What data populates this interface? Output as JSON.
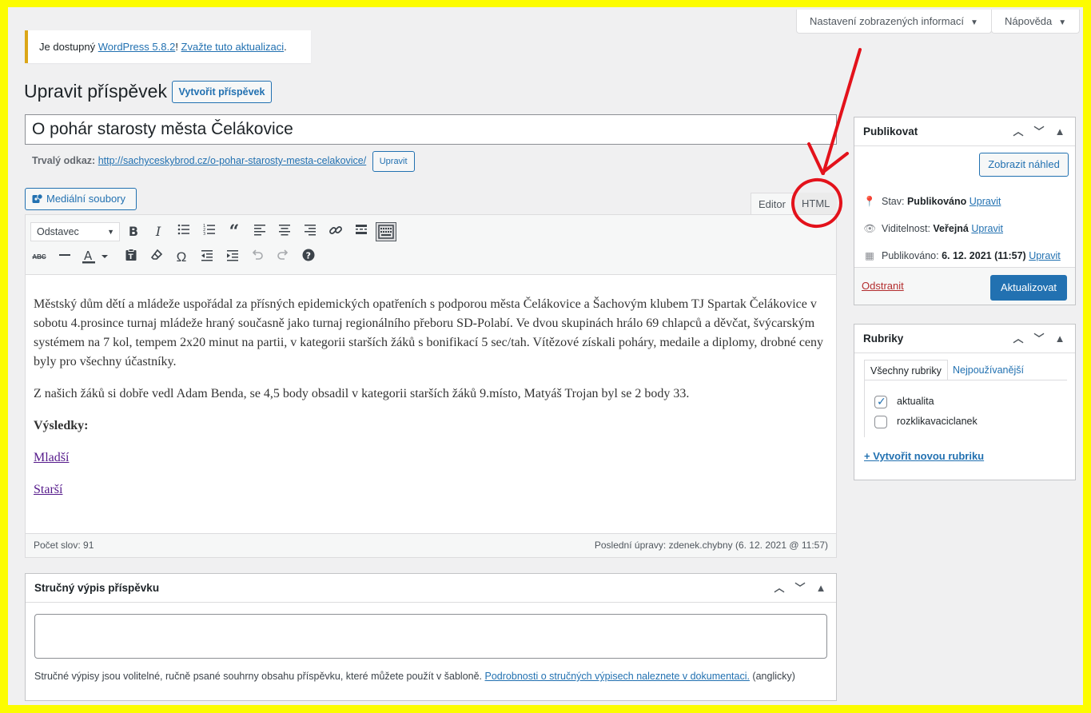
{
  "screen_options": {
    "label": "Nastavení zobrazených informací"
  },
  "help": {
    "label": "Nápověda"
  },
  "notice": {
    "prefix": "Je dostupný ",
    "version_link": "WordPress 5.8.2",
    "sep": "! ",
    "update_link": "Zvažte tuto aktualizaci",
    "suffix": "."
  },
  "page": {
    "title": "Upravit příspěvek",
    "new_post_button": "Vytvořit příspěvek"
  },
  "post": {
    "title": "O pohár starosty města Čelákovice",
    "permalink_label": "Trvalý odkaz:",
    "permalink_url": "http://sachyceskybrod.cz/o-pohar-starosty-mesta-celakovice/",
    "permalink_edit": "Upravit"
  },
  "editor": {
    "media_button": "Mediální soubory",
    "tab_visual": "Editor",
    "tab_html": "HTML",
    "format_select": "Odstavec",
    "icons": [
      "bold-icon",
      "italic-icon",
      "bullet-list-icon",
      "numbered-list-icon",
      "blockquote-icon",
      "align-left-icon",
      "align-center-icon",
      "align-right-icon",
      "link-icon",
      "read-more-icon",
      "toolbar-toggle-icon",
      "strikethrough-icon",
      "horizontal-line-icon",
      "text-color-icon",
      "paste-text-icon",
      "clear-formatting-icon",
      "special-character-icon",
      "outdent-icon",
      "indent-icon",
      "undo-icon",
      "redo-icon",
      "help-icon"
    ],
    "content": {
      "p1": "Městský dům dětí a mládeže uspořádal za přísných epidemických opatřeních s podporou města Čelákovice a Šachovým klubem TJ Spartak Čelákovice  v sobotu 4.prosince turnaj  mládeže hraný současně jako turnaj regionálního přeboru SD-Polabí. Ve dvou skupinách hrálo 69 chlapců a děvčat, švýcarským systémem na 7 kol, tempem 2x20 minut na partii, v kategorii starších žáků s bonifikací 5 sec/tah. Vítězové získali poháry, medaile a diplomy, drobné ceny byly pro všechny účastníky.",
      "p2": "Z našich žáků si dobře vedl Adam Benda, se 4,5 body obsadil v kategorii starších žáků 9.místo, Matyáš Trojan byl se 2 body 33.",
      "results_heading": "Výsledky:",
      "link_younger": "Mladší",
      "link_older": "Starší"
    },
    "word_count": "Počet slov: 91",
    "last_edit": "Poslední úpravy: zdenek.chybny (6. 12. 2021 @ 11:57)"
  },
  "excerpt": {
    "title": "Stručný výpis příspěvku",
    "value": "",
    "help_prefix": "Stručné výpisy jsou volitelné, ručně psané souhrny obsahu příspěvku, které můžete použít v šabloně. ",
    "help_link": "Podrobnosti o stručných výpisech naleznete v dokumentaci.",
    "help_suffix": " (anglicky)"
  },
  "publish": {
    "title": "Publikovat",
    "preview_button": "Zobrazit náhled",
    "status_label": "Stav: ",
    "status_value": "Publikováno",
    "visibility_label": "Viditelnost: ",
    "visibility_value": "Veřejná",
    "published_label": "Publikováno: ",
    "published_value": "6. 12. 2021 (11:57)",
    "edit_link": "Upravit",
    "delete_link": "Odstranit",
    "update_button": "Aktualizovat"
  },
  "categories": {
    "title": "Rubriky",
    "tab_all": "Všechny rubriky",
    "tab_popular": "Nejpoužívanější",
    "items": [
      {
        "label": "aktualita",
        "checked": true
      },
      {
        "label": "rozklikavaciclanek",
        "checked": false
      }
    ],
    "add_new": "+ Vytvořit novou rubriku"
  },
  "colors": {
    "frame": "#fcfc00",
    "accent": "#2271b1",
    "annotation": "#e3121b",
    "notice_border": "#dba617",
    "delete": "#b32d2e"
  }
}
